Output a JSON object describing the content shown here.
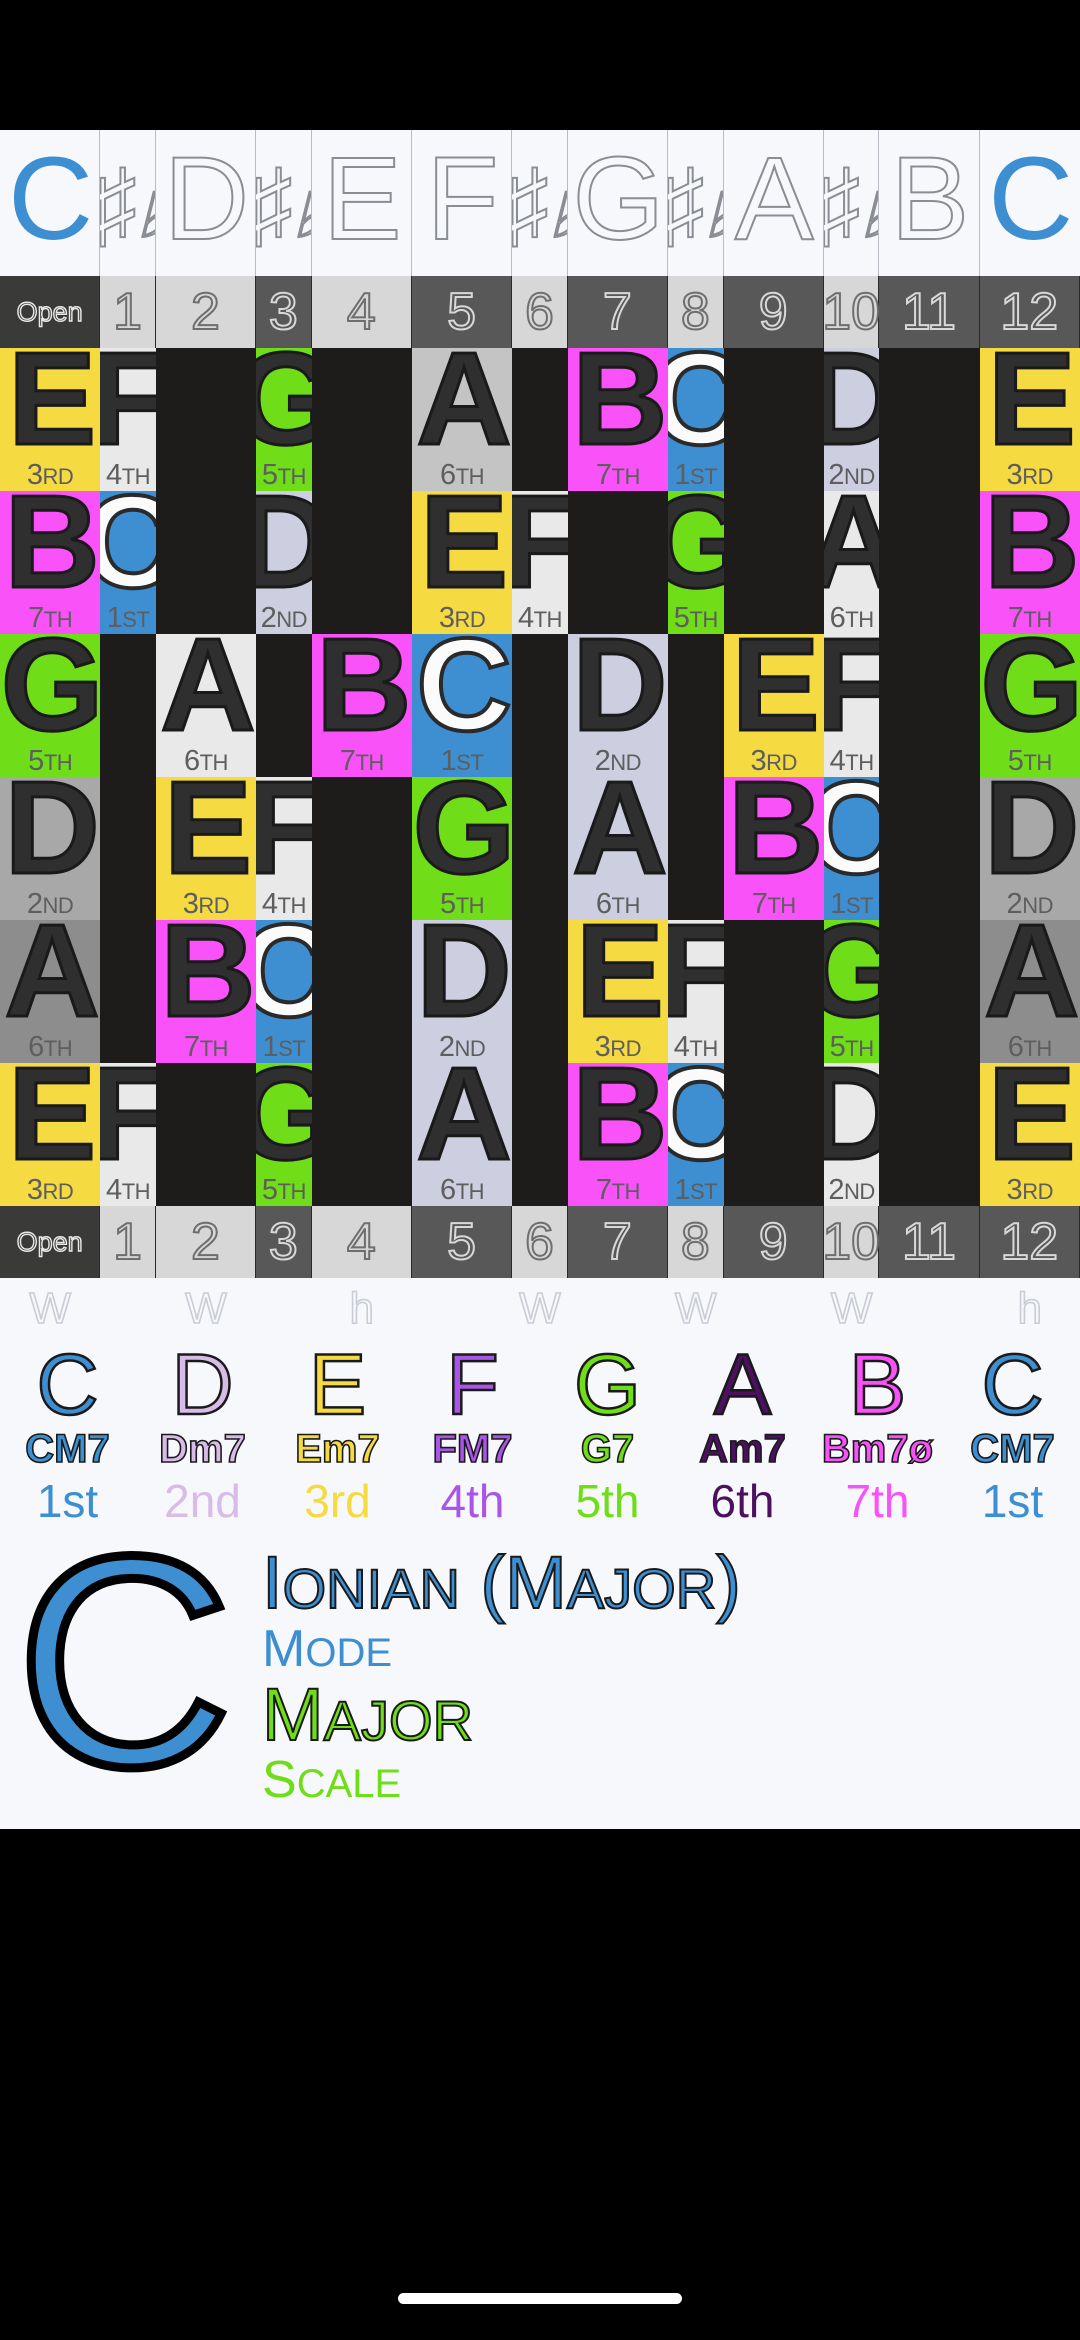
{
  "meta": {
    "key_letter": "C",
    "mode_title": "Ionian (Major)",
    "mode_label": "Mode",
    "scale_title": "Major",
    "scale_label": "Scale",
    "accent_blue": "#3d8fd1",
    "accent_green": "#6fdd17",
    "board_bg": "#f7f8fc",
    "fret_dark": "#1e1c1a"
  },
  "chromatic_header": [
    {
      "label": "C",
      "type": "natural",
      "highlight": true
    },
    {
      "label": "#b",
      "type": "accidental",
      "highlight": false
    },
    {
      "label": "D",
      "type": "natural",
      "highlight": false
    },
    {
      "label": "#b",
      "type": "accidental",
      "highlight": false
    },
    {
      "label": "E",
      "type": "natural",
      "highlight": false
    },
    {
      "label": "F",
      "type": "natural",
      "highlight": false
    },
    {
      "label": "#b",
      "type": "accidental",
      "highlight": false
    },
    {
      "label": "G",
      "type": "natural",
      "highlight": false
    },
    {
      "label": "#b",
      "type": "accidental",
      "highlight": false
    },
    {
      "label": "A",
      "type": "natural",
      "highlight": false
    },
    {
      "label": "#b",
      "type": "accidental",
      "highlight": false
    },
    {
      "label": "B",
      "type": "natural",
      "highlight": false
    },
    {
      "label": "C",
      "type": "natural",
      "highlight": true
    }
  ],
  "fret_numbers": [
    "Open",
    "1",
    "2",
    "3",
    "4",
    "5",
    "6",
    "7",
    "8",
    "9",
    "10",
    "11",
    "12"
  ],
  "fret_shades": [
    "open",
    "light",
    "light",
    "dark",
    "light",
    "dark",
    "light",
    "dark",
    "light",
    "dark",
    "light",
    "dark",
    "dark"
  ],
  "interval_steps": [
    "",
    "W",
    "",
    "W",
    "",
    "h",
    "",
    "W",
    "",
    "W",
    "",
    "W",
    "",
    "h"
  ],
  "note_colors": {
    "C": "#3d8fd1",
    "D": "#cdcee0",
    "E": "#f5da41",
    "F": "#e9e9ea",
    "G": "#6fdd17",
    "A": "#c4c4c4",
    "B": "#f952f9",
    "empty": "#1e1c1a"
  },
  "strings": [
    {
      "name": "string-1-high-e",
      "cells": [
        {
          "note": "E",
          "degree": "3",
          "suffix": "RD",
          "color": "#f5da41"
        },
        {
          "note": "F",
          "degree": "4",
          "suffix": "TH",
          "color": "#e9e9ea"
        },
        {
          "note": "",
          "degree": "",
          "suffix": "",
          "color": "#1e1c1a"
        },
        {
          "note": "G",
          "degree": "5",
          "suffix": "TH",
          "color": "#6fdd17"
        },
        {
          "note": "",
          "degree": "",
          "suffix": "",
          "color": "#1e1c1a"
        },
        {
          "note": "A",
          "degree": "6",
          "suffix": "TH",
          "color": "#c4c4c4"
        },
        {
          "note": "",
          "degree": "",
          "suffix": "",
          "color": "#1e1c1a"
        },
        {
          "note": "B",
          "degree": "7",
          "suffix": "TH",
          "color": "#f952f9"
        },
        {
          "note": "C",
          "degree": "1",
          "suffix": "ST",
          "color": "#3d8fd1"
        },
        {
          "note": "",
          "degree": "",
          "suffix": "",
          "color": "#1e1c1a"
        },
        {
          "note": "D",
          "degree": "2",
          "suffix": "ND",
          "color": "#cdcee0"
        },
        {
          "note": "",
          "degree": "",
          "suffix": "",
          "color": "#1e1c1a"
        },
        {
          "note": "E",
          "degree": "3",
          "suffix": "RD",
          "color": "#f5da41"
        }
      ]
    },
    {
      "name": "string-2-b",
      "cells": [
        {
          "note": "B",
          "degree": "7",
          "suffix": "TH",
          "color": "#f952f9"
        },
        {
          "note": "C",
          "degree": "1",
          "suffix": "ST",
          "color": "#3d8fd1"
        },
        {
          "note": "",
          "degree": "",
          "suffix": "",
          "color": "#1e1c1a"
        },
        {
          "note": "D",
          "degree": "2",
          "suffix": "ND",
          "color": "#cdcee0"
        },
        {
          "note": "",
          "degree": "",
          "suffix": "",
          "color": "#1e1c1a"
        },
        {
          "note": "E",
          "degree": "3",
          "suffix": "RD",
          "color": "#f5da41"
        },
        {
          "note": "F",
          "degree": "4",
          "suffix": "TH",
          "color": "#e9e9ea"
        },
        {
          "note": "",
          "degree": "",
          "suffix": "",
          "color": "#1e1c1a"
        },
        {
          "note": "G",
          "degree": "5",
          "suffix": "TH",
          "color": "#6fdd17"
        },
        {
          "note": "",
          "degree": "",
          "suffix": "",
          "color": "#1e1c1a"
        },
        {
          "note": "A",
          "degree": "6",
          "suffix": "TH",
          "color": "#e9e9ea"
        },
        {
          "note": "",
          "degree": "",
          "suffix": "",
          "color": "#1e1c1a"
        },
        {
          "note": "B",
          "degree": "7",
          "suffix": "TH",
          "color": "#f952f9"
        }
      ]
    },
    {
      "name": "string-3-g",
      "cells": [
        {
          "note": "G",
          "degree": "5",
          "suffix": "TH",
          "color": "#6fdd17"
        },
        {
          "note": "",
          "degree": "",
          "suffix": "",
          "color": "#1e1c1a"
        },
        {
          "note": "A",
          "degree": "6",
          "suffix": "TH",
          "color": "#e9e9ea"
        },
        {
          "note": "",
          "degree": "",
          "suffix": "",
          "color": "#1e1c1a"
        },
        {
          "note": "B",
          "degree": "7",
          "suffix": "TH",
          "color": "#f952f9"
        },
        {
          "note": "C",
          "degree": "1",
          "suffix": "ST",
          "color": "#3d8fd1"
        },
        {
          "note": "",
          "degree": "",
          "suffix": "",
          "color": "#1e1c1a"
        },
        {
          "note": "D",
          "degree": "2",
          "suffix": "ND",
          "color": "#cdcee0"
        },
        {
          "note": "",
          "degree": "",
          "suffix": "",
          "color": "#1e1c1a"
        },
        {
          "note": "E",
          "degree": "3",
          "suffix": "RD",
          "color": "#f5da41"
        },
        {
          "note": "F",
          "degree": "4",
          "suffix": "TH",
          "color": "#e9e9ea"
        },
        {
          "note": "",
          "degree": "",
          "suffix": "",
          "color": "#1e1c1a"
        },
        {
          "note": "G",
          "degree": "5",
          "suffix": "TH",
          "color": "#6fdd17"
        }
      ]
    },
    {
      "name": "string-4-d",
      "cells": [
        {
          "note": "D",
          "degree": "2",
          "suffix": "ND",
          "color": "#a8a8a8"
        },
        {
          "note": "",
          "degree": "",
          "suffix": "",
          "color": "#1e1c1a"
        },
        {
          "note": "E",
          "degree": "3",
          "suffix": "RD",
          "color": "#f5da41"
        },
        {
          "note": "F",
          "degree": "4",
          "suffix": "TH",
          "color": "#e9e9ea"
        },
        {
          "note": "",
          "degree": "",
          "suffix": "",
          "color": "#1e1c1a"
        },
        {
          "note": "G",
          "degree": "5",
          "suffix": "TH",
          "color": "#6fdd17"
        },
        {
          "note": "",
          "degree": "",
          "suffix": "",
          "color": "#1e1c1a"
        },
        {
          "note": "A",
          "degree": "6",
          "suffix": "TH",
          "color": "#cdcee0"
        },
        {
          "note": "",
          "degree": "",
          "suffix": "",
          "color": "#1e1c1a"
        },
        {
          "note": "B",
          "degree": "7",
          "suffix": "TH",
          "color": "#f952f9"
        },
        {
          "note": "C",
          "degree": "1",
          "suffix": "ST",
          "color": "#3d8fd1"
        },
        {
          "note": "",
          "degree": "",
          "suffix": "",
          "color": "#1e1c1a"
        },
        {
          "note": "D",
          "degree": "2",
          "suffix": "ND",
          "color": "#a8a8a8"
        }
      ]
    },
    {
      "name": "string-5-a",
      "cells": [
        {
          "note": "A",
          "degree": "6",
          "suffix": "TH",
          "color": "#8d8d8d"
        },
        {
          "note": "",
          "degree": "",
          "suffix": "",
          "color": "#1e1c1a"
        },
        {
          "note": "B",
          "degree": "7",
          "suffix": "TH",
          "color": "#f952f9"
        },
        {
          "note": "C",
          "degree": "1",
          "suffix": "ST",
          "color": "#3d8fd1"
        },
        {
          "note": "",
          "degree": "",
          "suffix": "",
          "color": "#1e1c1a"
        },
        {
          "note": "D",
          "degree": "2",
          "suffix": "ND",
          "color": "#cdcee0"
        },
        {
          "note": "",
          "degree": "",
          "suffix": "",
          "color": "#1e1c1a"
        },
        {
          "note": "E",
          "degree": "3",
          "suffix": "RD",
          "color": "#f5da41"
        },
        {
          "note": "F",
          "degree": "4",
          "suffix": "TH",
          "color": "#e9e9ea"
        },
        {
          "note": "",
          "degree": "",
          "suffix": "",
          "color": "#1e1c1a"
        },
        {
          "note": "G",
          "degree": "5",
          "suffix": "TH",
          "color": "#6fdd17"
        },
        {
          "note": "",
          "degree": "",
          "suffix": "",
          "color": "#1e1c1a"
        },
        {
          "note": "A",
          "degree": "6",
          "suffix": "TH",
          "color": "#8d8d8d"
        }
      ]
    },
    {
      "name": "string-6-low-e",
      "cells": [
        {
          "note": "E",
          "degree": "3",
          "suffix": "RD",
          "color": "#f5da41"
        },
        {
          "note": "F",
          "degree": "4",
          "suffix": "TH",
          "color": "#e9e9ea"
        },
        {
          "note": "",
          "degree": "",
          "suffix": "",
          "color": "#1e1c1a"
        },
        {
          "note": "G",
          "degree": "5",
          "suffix": "TH",
          "color": "#6fdd17"
        },
        {
          "note": "",
          "degree": "",
          "suffix": "",
          "color": "#1e1c1a"
        },
        {
          "note": "A",
          "degree": "6",
          "suffix": "TH",
          "color": "#cdcee0"
        },
        {
          "note": "",
          "degree": "",
          "suffix": "",
          "color": "#1e1c1a"
        },
        {
          "note": "B",
          "degree": "7",
          "suffix": "TH",
          "color": "#f952f9"
        },
        {
          "note": "C",
          "degree": "1",
          "suffix": "ST",
          "color": "#3d8fd1"
        },
        {
          "note": "",
          "degree": "",
          "suffix": "",
          "color": "#1e1c1a"
        },
        {
          "note": "D",
          "degree": "2",
          "suffix": "ND",
          "color": "#e9e9ea"
        },
        {
          "note": "",
          "degree": "",
          "suffix": "",
          "color": "#1e1c1a"
        },
        {
          "note": "E",
          "degree": "3",
          "suffix": "RD",
          "color": "#f5da41"
        }
      ]
    }
  ],
  "scale_degrees": [
    {
      "letter": "C",
      "chord": "CM7",
      "ordinal": "1st",
      "color": "#3d8fd1"
    },
    {
      "letter": "D",
      "chord": "Dm7",
      "ordinal": "2nd",
      "color": "#d8bce8"
    },
    {
      "letter": "E",
      "chord": "Em7",
      "ordinal": "3rd",
      "color": "#f5da41"
    },
    {
      "letter": "F",
      "chord": "FM7",
      "ordinal": "4th",
      "color": "#a855e8"
    },
    {
      "letter": "G",
      "chord": "G7",
      "ordinal": "5th",
      "color": "#6fdd17"
    },
    {
      "letter": "A",
      "chord": "Am7",
      "ordinal": "6th",
      "color": "#4b1060"
    },
    {
      "letter": "B",
      "chord": "Bm7ø",
      "ordinal": "7th",
      "color": "#f952f9"
    },
    {
      "letter": "C",
      "chord": "CM7",
      "ordinal": "1st",
      "color": "#3d8fd1"
    }
  ]
}
